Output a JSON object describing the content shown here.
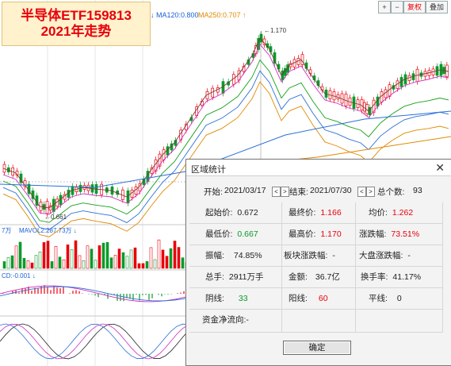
{
  "overlay_title": {
    "line1": "半导体ETF159813",
    "line2": "2021年走势"
  },
  "ma_legend": {
    "ma120": "MA120:0.800",
    "ma250": "MA250:0.707"
  },
  "top_buttons": {
    "plus": "+",
    "minus": "−",
    "fuquan": "复权",
    "overlay": "叠加"
  },
  "chart_labels": {
    "high_marker": "←1.170",
    "low_marker": "←0.661",
    "volume_legend": "7万",
    "mavol2": "MAVOL2:287.73万",
    "macd_legend": "CD:-0.001"
  },
  "dialog": {
    "title": "区域统计",
    "start_label": "开始:",
    "start_date": "2021/03/17",
    "end_label": "结束:",
    "end_date": "2021/07/30",
    "count_label": "总个数:",
    "count": "93",
    "open_label": "起始价:",
    "open": "0.672",
    "close_label": "最终价:",
    "close": "1.166",
    "avg_label": "均价:",
    "avg": "1.262",
    "low_label": "最低价:",
    "low": "0.667",
    "high_label": "最高价:",
    "high": "1.170",
    "change_label": "涨跌幅:",
    "change": "73.51%",
    "amplitude_label": "振幅:",
    "amplitude": "74.85%",
    "sector_label": "板块涨跌幅:",
    "sector": "-",
    "market_label": "大盘涨跌幅:",
    "market": "-",
    "volume_label": "总手:",
    "volume": "2911万手",
    "amount_label": "金额:",
    "amount": "36.7亿",
    "turnover_label": "换手率:",
    "turnover": "41.17%",
    "down_label": "阴线:",
    "down": "33",
    "up_label": "阳线:",
    "up": "60",
    "flat_label": "平线:",
    "flat": "0",
    "flow_label": "资金净流向:",
    "flow": "-",
    "ok": "确定"
  },
  "colors": {
    "up": "#e8000b",
    "down": "#0a9a2a",
    "title_bg": "#fff2cc"
  }
}
